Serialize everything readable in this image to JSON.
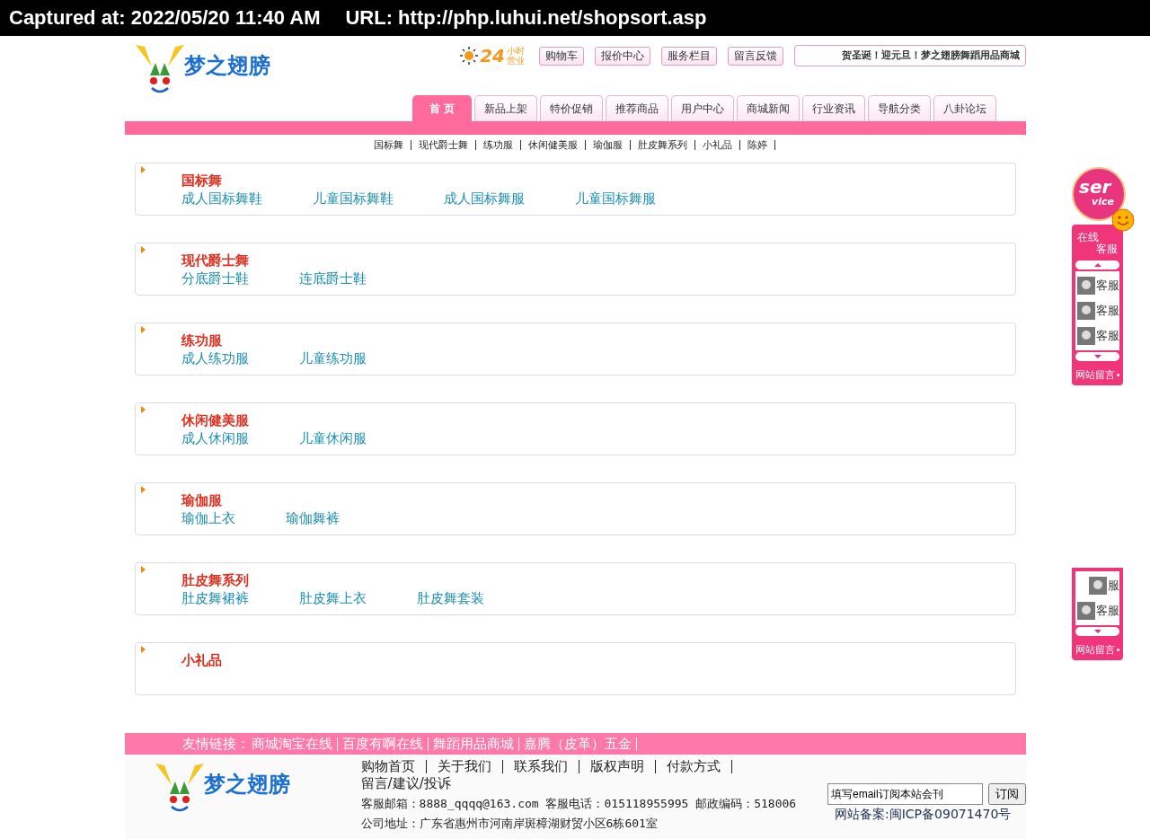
{
  "capture_bar": {
    "captured": "Captured at: 2022/05/20 11:40 AM",
    "url": "URL: http://php.luhui.net/shopsort.asp"
  },
  "header": {
    "logo_text": "梦之翅膀",
    "hours_number": "24",
    "hours_text": "小时营业",
    "top_links": [
      "购物车",
      "报价中心",
      "服务栏目",
      "留言反馈"
    ],
    "marquee": "贺圣诞！迎元旦！梦之翅膀舞蹈用品商城"
  },
  "nav_tabs": [
    {
      "label": "首 页",
      "selected": true
    },
    {
      "label": "新品上架",
      "selected": false
    },
    {
      "label": "特价促销",
      "selected": false
    },
    {
      "label": "推荐商品",
      "selected": false
    },
    {
      "label": "用户中心",
      "selected": false
    },
    {
      "label": "商城新闻",
      "selected": false
    },
    {
      "label": "行业资讯",
      "selected": false
    },
    {
      "label": "导航分类",
      "selected": false
    },
    {
      "label": "八卦论坛",
      "selected": false
    }
  ],
  "sub_nav": [
    "国标舞",
    "现代爵士舞",
    "练功服",
    "休闲健美服",
    "瑜伽服",
    "肚皮舞系列",
    "小礼品",
    "陈婷"
  ],
  "categories": [
    {
      "title": "国标舞",
      "items": [
        "成人国标舞鞋",
        "儿童国标舞鞋",
        "成人国标舞服",
        "儿童国标舞服"
      ]
    },
    {
      "title": "现代爵士舞",
      "items": [
        "分底爵士鞋",
        "连底爵士鞋"
      ]
    },
    {
      "title": "练功服",
      "items": [
        "成人练功服",
        "儿童练功服"
      ]
    },
    {
      "title": "休闲健美服",
      "items": [
        "成人休闲服",
        "儿童休闲服"
      ]
    },
    {
      "title": "瑜伽服",
      "items": [
        "瑜伽上衣",
        "瑜伽舞裤"
      ]
    },
    {
      "title": "肚皮舞系列",
      "items": [
        "肚皮舞裙裤",
        "肚皮舞上衣",
        "肚皮舞套装"
      ]
    },
    {
      "title": "小礼品"
    }
  ],
  "service_widget": {
    "badge_top": "ser",
    "badge_bottom": "vice",
    "title_line1": "在线",
    "title_line2": "客服",
    "agents": [
      "客服",
      "客服",
      "客服"
    ],
    "message_link": "网站留言"
  },
  "service_widget_lower": {
    "agents": [
      "服",
      "客服"
    ],
    "message_link": "网站留言"
  },
  "footer": {
    "friend_links_label": "友情链接：",
    "friend_links": [
      "商城淘宝在线",
      "百度有啊在线",
      "舞蹈用品商城",
      "嘉腾（皮革）五金"
    ],
    "logo_text": "梦之翅膀",
    "links": [
      "购物首页",
      "关于我们",
      "联系我们",
      "版权声明",
      "付款方式",
      "留言/建议/投诉"
    ],
    "contact": "客服邮箱：8888_qqqq@163.com  客服电话：015118955995 邮政编码：518006",
    "address": "公司地址：广东省惠州市河南岸斑樟湖财贸小区6栋601室",
    "subscribe_placeholder": "填写email订阅本站会刊",
    "subscribe_button": "订阅",
    "icp": "网站备案:闽ICP备09071470号"
  }
}
